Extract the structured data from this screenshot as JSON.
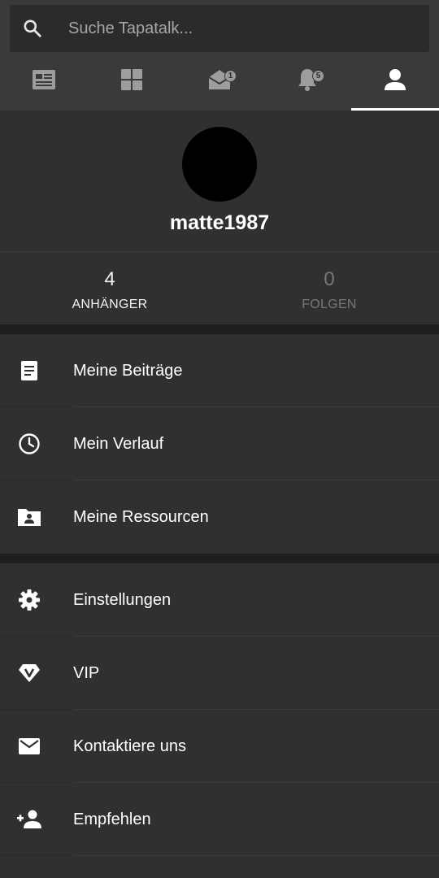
{
  "search": {
    "placeholder": "Suche Tapatalk...",
    "icon": "search-icon"
  },
  "tabs": [
    {
      "name": "feed",
      "icon": "feed-icon",
      "badge": ""
    },
    {
      "name": "forums",
      "icon": "grid-icon",
      "badge": ""
    },
    {
      "name": "messages",
      "icon": "mail-open-icon",
      "badge": "1"
    },
    {
      "name": "notifications",
      "icon": "bell-icon",
      "badge": "5"
    },
    {
      "name": "profile",
      "icon": "person-icon",
      "badge": "",
      "active": true
    }
  ],
  "profile": {
    "username": "matte1987",
    "followers": {
      "count": "4",
      "label": "ANHÄNGER"
    },
    "following": {
      "count": "0",
      "label": "FOLGEN"
    }
  },
  "menu_group1": [
    {
      "label": "Meine Beiträge",
      "icon": "document-icon"
    },
    {
      "label": "Mein Verlauf",
      "icon": "clock-icon"
    },
    {
      "label": "Meine Ressourcen",
      "icon": "folder-person-icon"
    }
  ],
  "menu_group2": [
    {
      "label": "Einstellungen",
      "icon": "gear-icon"
    },
    {
      "label": "VIP",
      "icon": "vip-diamond-icon"
    },
    {
      "label": "Kontaktiere uns",
      "icon": "envelope-icon"
    },
    {
      "label": "Empfehlen",
      "icon": "add-person-icon"
    }
  ],
  "colors": {
    "background": "#303032",
    "header": "#3a3a3c",
    "divider": "#1f1f21",
    "muted": "#77777a"
  }
}
